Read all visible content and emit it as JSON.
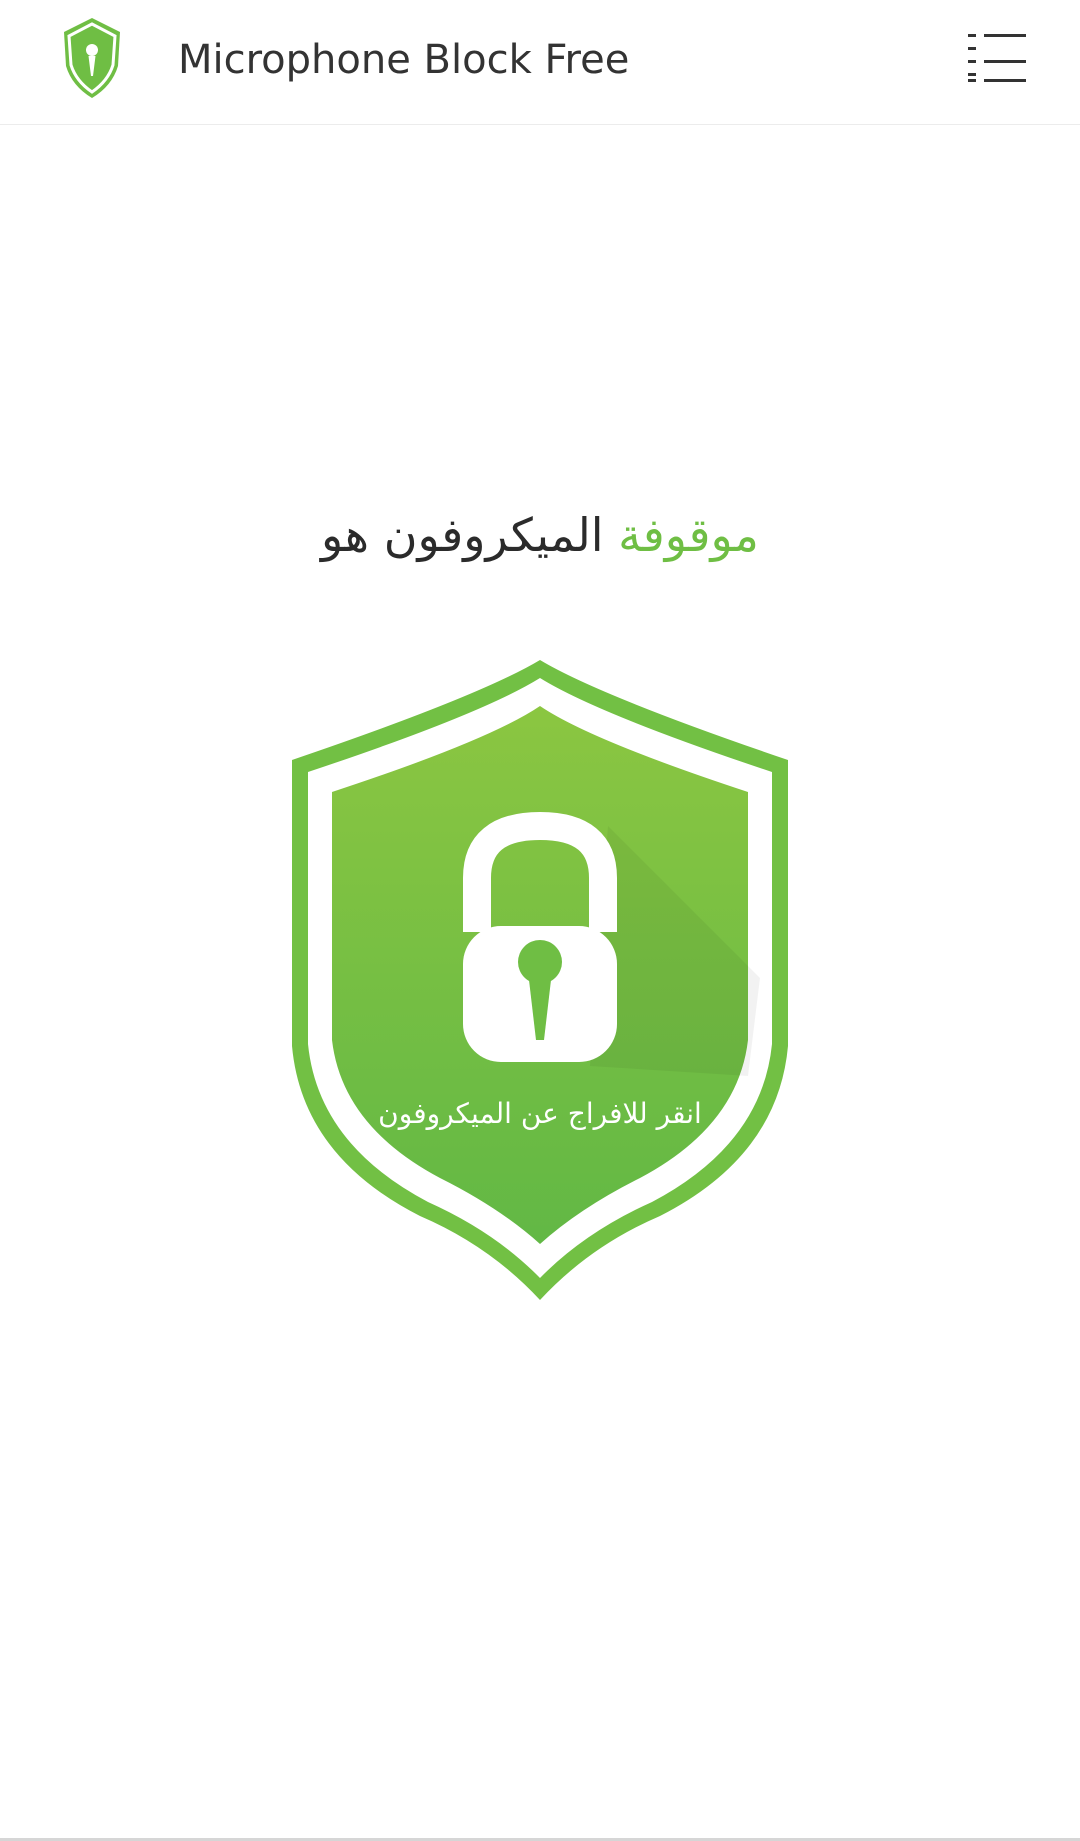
{
  "header": {
    "app_title": "Microphone Block Free",
    "logo_icon": "microphone-shield-icon",
    "menu_icon": "menu-list-icon"
  },
  "status": {
    "microphone_label": "الميكروفون هو",
    "state_label": "موقوفة"
  },
  "shield": {
    "icon": "padlock-microphone-icon",
    "caption": "انقر للافراج عن الميكروفون"
  },
  "colors": {
    "accent": "#6fbe44",
    "shield_outer": "#72c044",
    "shield_inner": "#85c443",
    "text_dark": "#2b2b2b"
  }
}
